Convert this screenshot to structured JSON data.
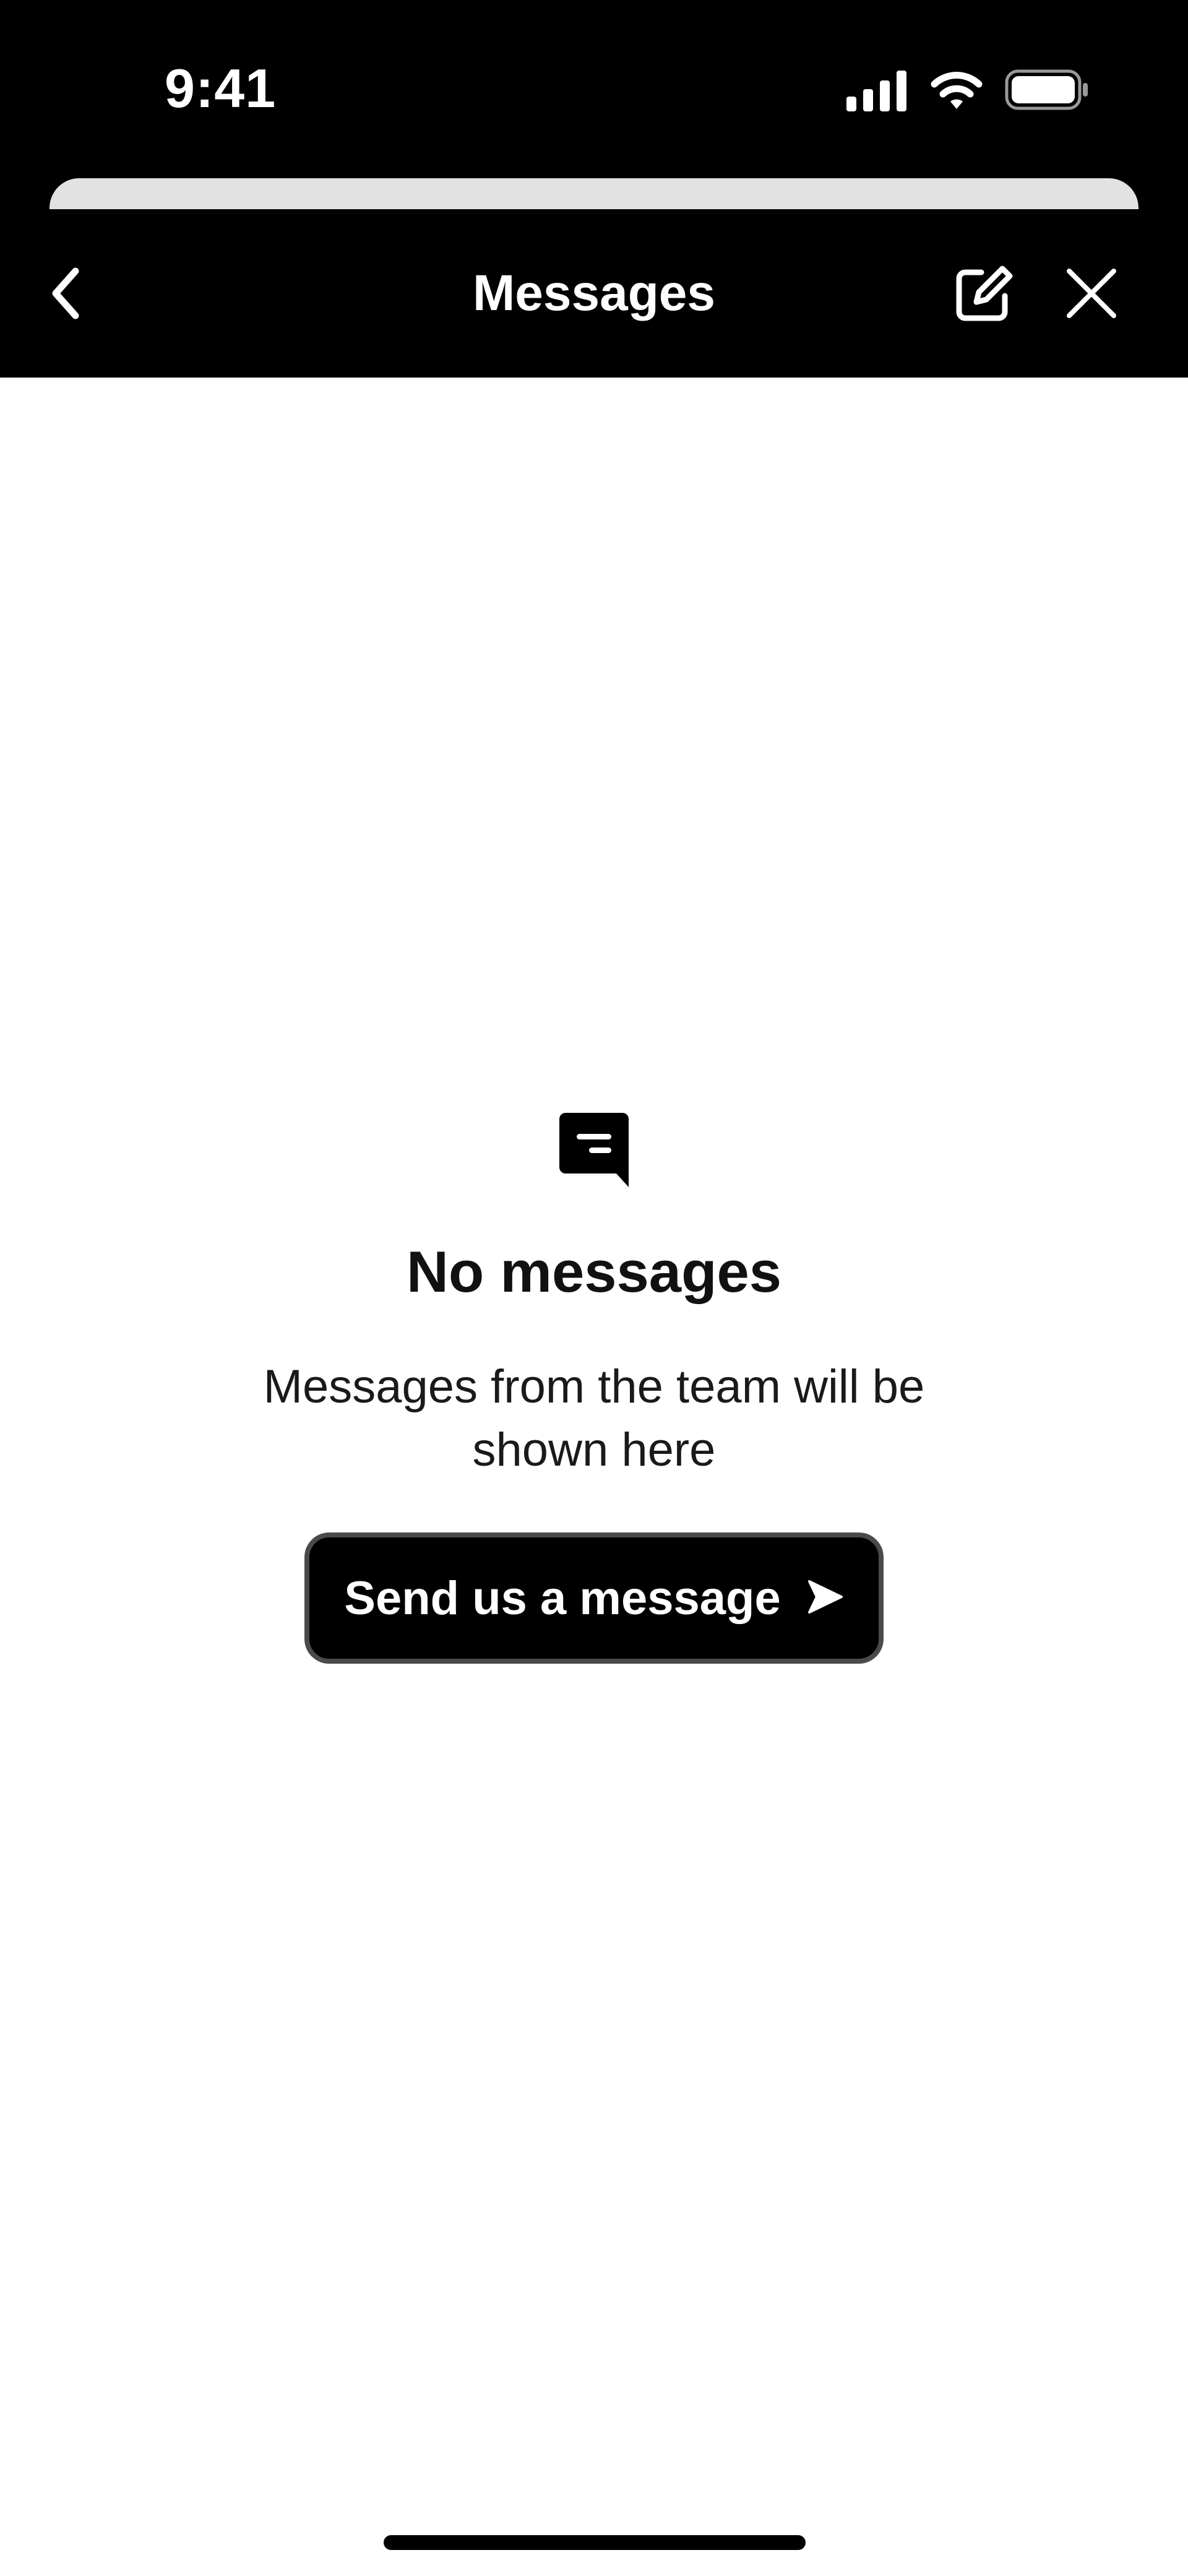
{
  "status_bar": {
    "time": "9:41",
    "signal_icon": "cellular-signal-icon",
    "wifi_icon": "wifi-icon",
    "battery_icon": "battery-icon"
  },
  "nav": {
    "title": "Messages",
    "back_icon": "chevron-left-icon",
    "compose_icon": "compose-icon",
    "close_icon": "close-icon"
  },
  "empty_state": {
    "icon": "message-bubble-icon",
    "title": "No messages",
    "subtitle": "Messages from the team will be shown here",
    "cta_label": "Send us a message",
    "cta_icon": "send-arrow-icon"
  },
  "colors": {
    "background": "#000000",
    "content_background": "#ffffff",
    "sheet_edge": "#e2e2e2",
    "button_border": "#4a4a4a"
  }
}
